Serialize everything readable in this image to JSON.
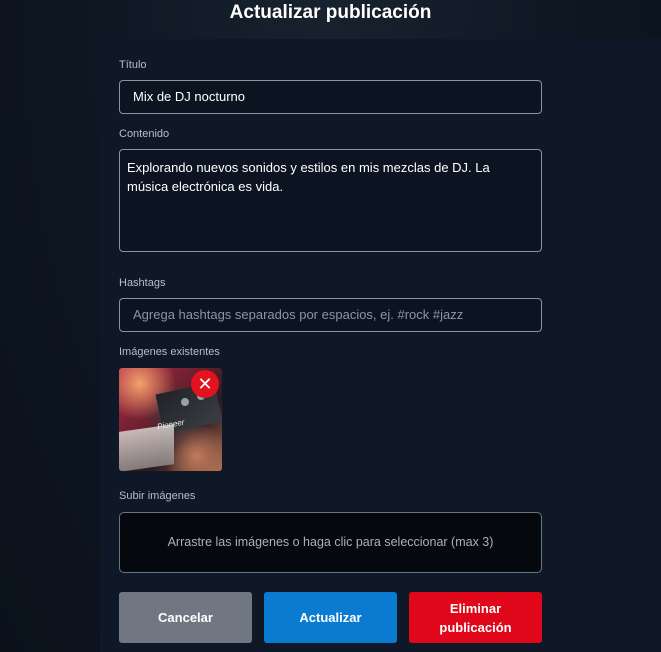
{
  "header": {
    "title": "Actualizar publicación"
  },
  "form": {
    "title_label": "Título",
    "title_value": "Mix de DJ nocturno",
    "content_label": "Contenido",
    "content_value": "Explorando nuevos sonidos y estilos en mis mezclas de DJ. La música electrónica es vida.",
    "hashtags_label": "Hashtags",
    "hashtags_placeholder": "Agrega hashtags separados por espacios, ej. #rock #jazz",
    "existing_images_label": "Imágenes existentes",
    "upload_label": "Subir imágenes",
    "dropzone_text": "Arrastre las imágenes o haga clic para seleccionar (max 3)",
    "thumbnail_brand": "Pioneer",
    "remove_icon": "✕"
  },
  "actions": {
    "cancel": "Cancelar",
    "update": "Actualizar",
    "delete": "Eliminar publicación"
  },
  "colors": {
    "primary": "#0b7bd2",
    "danger": "#e0071a",
    "neutral": "#707782"
  }
}
